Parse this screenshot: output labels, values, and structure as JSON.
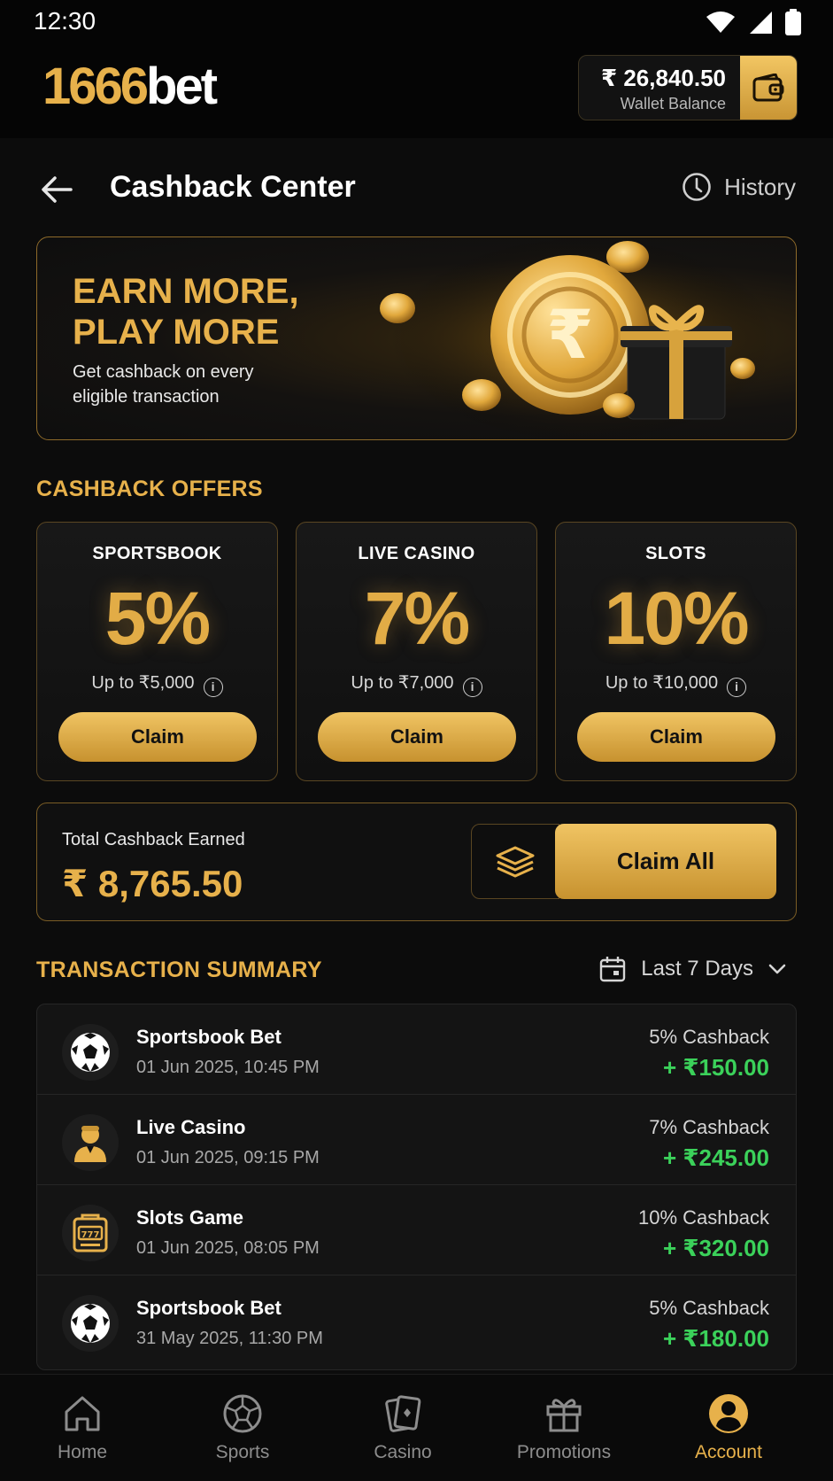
{
  "status_bar": {
    "time": "12:30"
  },
  "header": {
    "logo_num": "1666",
    "logo_text": "bet",
    "wallet_amount": "₹ 26,840.50",
    "wallet_label": "Wallet Balance"
  },
  "page": {
    "title": "Cashback Center",
    "history_label": "History"
  },
  "banner": {
    "headline": "EARN MORE,\nPLAY MORE",
    "subtext": "Get cashback on every eligible transaction"
  },
  "offers_section": {
    "title": "CASHBACK OFFERS",
    "offers": [
      {
        "name": "SPORTSBOOK",
        "percent": "5%",
        "limit": "Up to ₹5,000",
        "button": "Claim"
      },
      {
        "name": "LIVE CASINO",
        "percent": "7%",
        "limit": "Up to ₹7,000",
        "button": "Claim"
      },
      {
        "name": "SLOTS",
        "percent": "10%",
        "limit": "Up to ₹10,000",
        "button": "Claim"
      }
    ]
  },
  "total": {
    "label": "Total Cashback Earned",
    "value": "₹ 8,765.50",
    "claim_all": "Claim All"
  },
  "transactions": {
    "title": "TRANSACTION SUMMARY",
    "filter": "Last 7 Days",
    "rows": [
      {
        "icon": "soccer-ball-icon",
        "name": "Sportsbook Bet",
        "date": "01 Jun 2025, 10:45 PM",
        "rate": "5% Cashback",
        "amount": "+ ₹150.00"
      },
      {
        "icon": "dealer-icon",
        "name": "Live Casino",
        "date": "01 Jun 2025, 09:15 PM",
        "rate": "7% Cashback",
        "amount": "+ ₹245.00"
      },
      {
        "icon": "slot-machine-icon",
        "name": "Slots Game",
        "date": "01 Jun 2025, 08:05 PM",
        "rate": "10% Cashback",
        "amount": "+ ₹320.00"
      },
      {
        "icon": "soccer-ball-icon",
        "name": "Sportsbook Bet",
        "date": "31 May 2025, 11:30 PM",
        "rate": "5% Cashback",
        "amount": "+ ₹180.00"
      }
    ]
  },
  "bottom_nav": {
    "items": [
      {
        "label": "Home",
        "icon": "home-icon"
      },
      {
        "label": "Sports",
        "icon": "sports-ball-icon"
      },
      {
        "label": "Casino",
        "icon": "cards-icon"
      },
      {
        "label": "Promotions",
        "icon": "gift-icon"
      },
      {
        "label": "Account",
        "icon": "account-icon",
        "active": true
      }
    ]
  },
  "colors": {
    "accent": "#e7b14b",
    "positive": "#3bd15a",
    "background": "#0c0c0c"
  }
}
